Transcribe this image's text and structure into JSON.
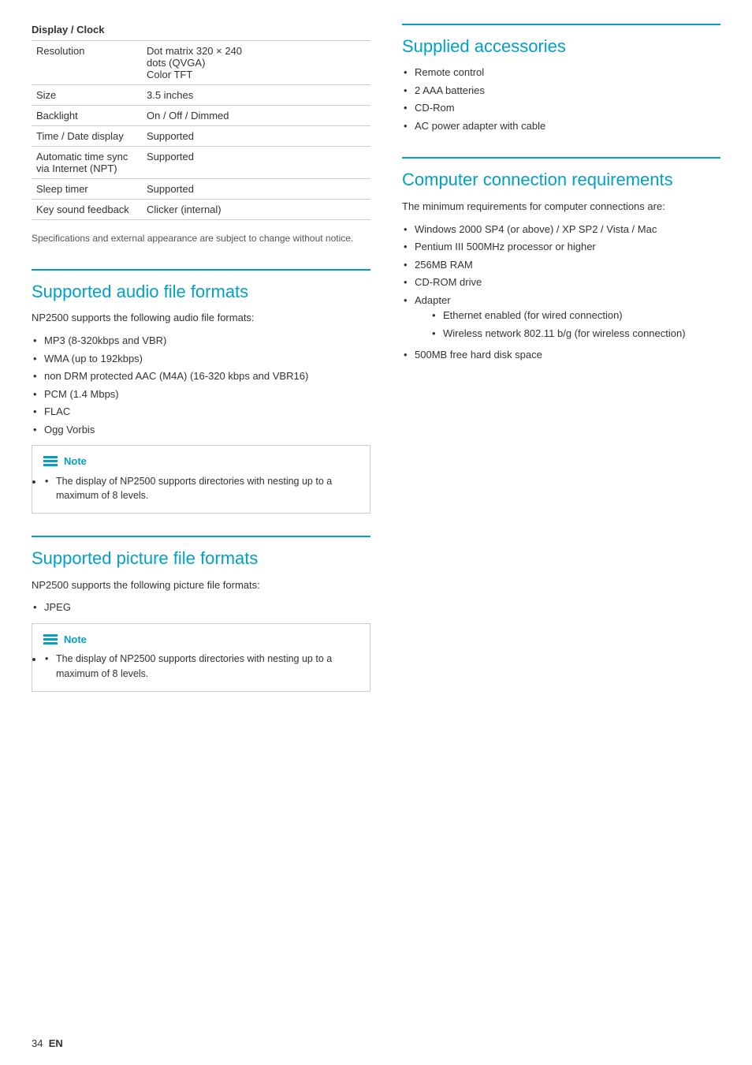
{
  "displayClock": {
    "title": "Display / Clock",
    "rows": [
      {
        "label": "Resolution",
        "value": "Dot matrix 320 × 240\ndots (QVGA)\nColor TFT"
      },
      {
        "label": "Size",
        "value": "3.5 inches"
      },
      {
        "label": "Backlight",
        "value": "On / Off / Dimmed"
      },
      {
        "label": "Time / Date display",
        "value": "Supported"
      },
      {
        "label": "Automatic time sync\nvia Internet (NPT)",
        "value": "Supported"
      },
      {
        "label": "Sleep timer",
        "value": "Supported"
      },
      {
        "label": "Key sound feedback",
        "value": "Clicker (internal)"
      }
    ],
    "note": "Specifications and external appearance are subject to change without notice."
  },
  "audioFormats": {
    "sectionTitle": "Supported audio file formats",
    "intro": "NP2500 supports the following audio file formats:",
    "items": [
      "MP3 (8-320kbps and VBR)",
      "WMA (up to 192kbps)",
      "non DRM protected AAC (M4A) (16-320 kbps and VBR16)",
      "PCM (1.4 Mbps)",
      "FLAC",
      "Ogg Vorbis"
    ],
    "noteLabel": "Note",
    "noteContent": "The display of NP2500 supports directories with nesting up to a maximum of 8 levels."
  },
  "pictureFormats": {
    "sectionTitle": "Supported picture file formats",
    "intro": "NP2500 supports the following picture file formats:",
    "items": [
      "JPEG"
    ],
    "noteLabel": "Note",
    "noteContent": "The display of NP2500 supports directories with nesting up to a maximum of 8 levels."
  },
  "suppliedAccessories": {
    "sectionTitle": "Supplied accessories",
    "items": [
      "Remote control",
      "2 AAA batteries",
      "CD-Rom",
      "AC power adapter with cable"
    ]
  },
  "computerConnection": {
    "sectionTitle": "Computer connection requirements",
    "intro": "The minimum requirements for computer connections are:",
    "items": [
      "Windows 2000 SP4 (or above) / XP SP2 / Vista / Mac",
      "Pentium III 500MHz processor or higher",
      "256MB RAM",
      "CD-ROM drive",
      "Adapter",
      "500MB free hard disk space"
    ],
    "adapterSubItems": [
      "Ethernet enabled (for wired connection)",
      "Wireless network 802.11 b/g (for wireless connection)"
    ]
  },
  "footer": {
    "pageNumber": "34",
    "lang": "EN"
  }
}
